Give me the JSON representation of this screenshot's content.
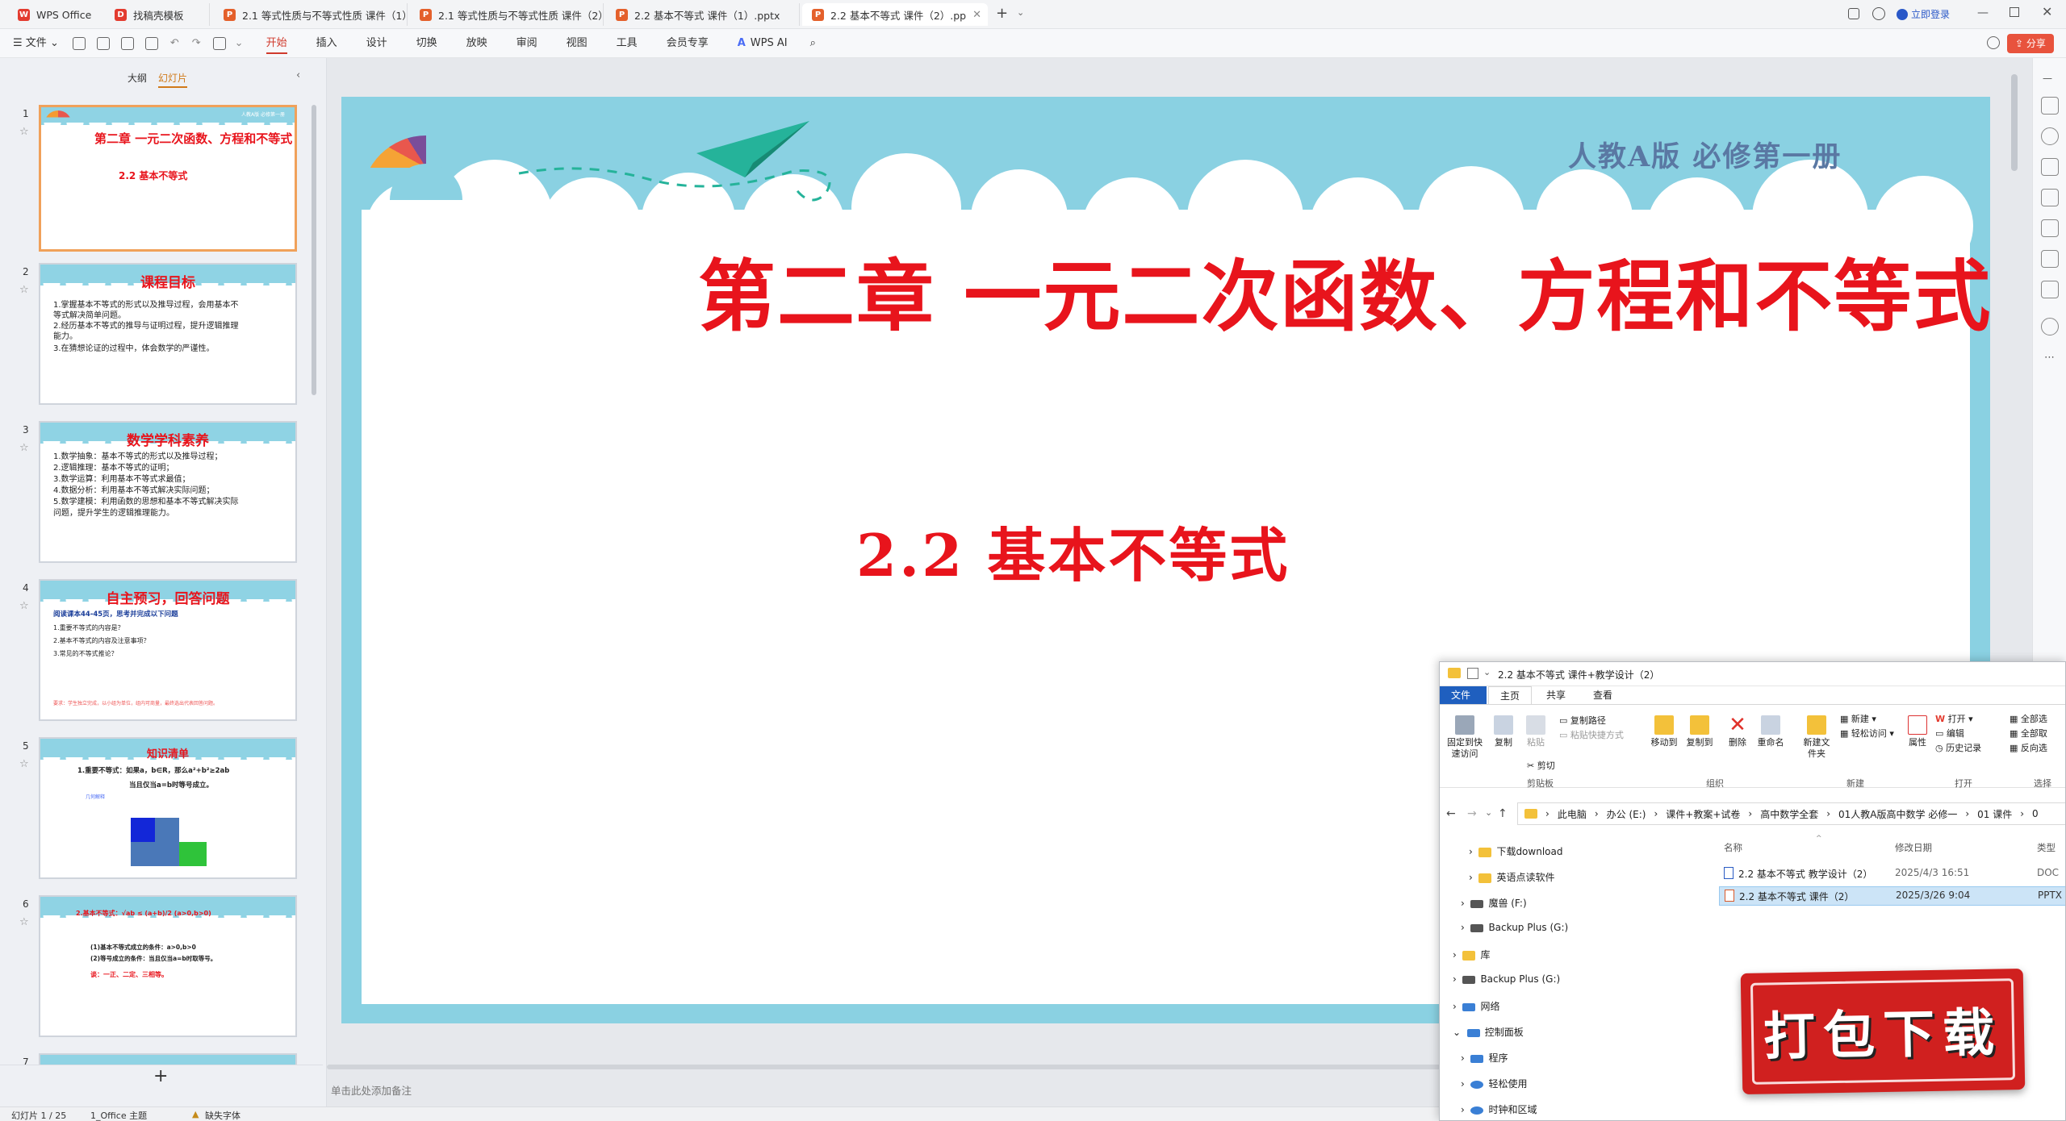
{
  "tabs": [
    {
      "label": "WPS Office",
      "color": "#e33b2f",
      "glyph": "W"
    },
    {
      "label": "找稿壳模板",
      "color": "#e33b2f",
      "glyph": "D"
    },
    {
      "label": "2.1 等式性质与不等式性质 课件（1）",
      "color": "#e4602b",
      "glyph": "P"
    },
    {
      "label": "2.1 等式性质与不等式性质 课件（2）",
      "color": "#e4602b",
      "glyph": "P"
    },
    {
      "label": "2.2 基本不等式 课件（1）.pptx",
      "color": "#e4602b",
      "glyph": "P"
    },
    {
      "label": "2.2 基本不等式 课件（2）.pp",
      "color": "#e4602b",
      "glyph": "P"
    }
  ],
  "titlebar": {
    "login": "立即登录",
    "share": "分享"
  },
  "menu": {
    "file": "文件",
    "items": [
      "开始",
      "插入",
      "设计",
      "切换",
      "放映",
      "审阅",
      "视图",
      "工具",
      "会员专享"
    ],
    "ai": "WPS AI"
  },
  "panel": {
    "outline": "大纲",
    "slides": "幻灯片",
    "add": "+"
  },
  "thumbs": [
    {
      "num": "1",
      "title": "第二章 一元二次函数、方程和不等式",
      "sub": "2.2 基本不等式",
      "tag": "人教A版 必修第一册"
    },
    {
      "num": "2",
      "title": "课程目标",
      "lines": [
        "1.掌握基本不等式的形式以及推导过程，会用基本不",
        "等式解决简单问题。",
        "2.经历基本不等式的推导与证明过程，提升逻辑推理",
        "能力。",
        "3.在猜想论证的过程中，体会数学的严谨性。"
      ]
    },
    {
      "num": "3",
      "title": "数学学科素养",
      "lines": [
        "1.数学抽象：基本不等式的形式以及推导过程；",
        "2.逻辑推理：基本不等式的证明；",
        "3.数学运算：利用基本不等式求最值；",
        "4.数据分析：利用基本不等式解决实际问题；",
        "5.数学建模：利用函数的思想和基本不等式解决实际",
        "问题，提升学生的逻辑推理能力。"
      ]
    },
    {
      "num": "4",
      "title": "自主预习，回答问题",
      "lines": [
        "阅读课本44-45页，思考并完成以下问题",
        "1.重要不等式的内容是？",
        "2.基本不等式的内容及注意事项？",
        "3.常见的不等式推论？"
      ],
      "foot": "要求：学生独立完成，以小组为单位，组内可商量，最终选出代表回答问题。"
    },
    {
      "num": "5",
      "title": "知识清单",
      "lines": [
        "1.重要不等式：如果a，b∈R，那么a²+b²≥2ab",
        "当且仅当a=b时等号成立。"
      ],
      "note": "几何解释"
    },
    {
      "num": "6",
      "title": "",
      "lines": [
        "2.基本不等式：√ab ≤ (a+b)/2 (a>0,b>0)",
        "(1)基本不等式成立的条件：a>0,b>0",
        "(2)等号成立的条件：当且仅当a=b时取等号。",
        "谈：一正、二定、三相等。"
      ]
    },
    {
      "num": "7",
      "title": ""
    }
  ],
  "slide": {
    "tag": "人教A版 必修第一册",
    "title": "第二章  一元二次函数、方程和不等式",
    "subtitle": "2.2  基本不等式",
    "notes": "单击此处添加备注",
    "badge": "打包下载"
  },
  "colors": {
    "title_red": "#e8141c",
    "sky": "#8ad1e2",
    "accent": "#d03a2c"
  },
  "status": {
    "page": "幻灯片 1 / 25",
    "theme": "1_Office 主题",
    "font": "缺失字体"
  },
  "explorer": {
    "title": "2.2 基本不等式 课件+教学设计（2）",
    "ribbon_tabs": [
      "文件",
      "主页",
      "共享",
      "查看"
    ],
    "buttons": {
      "pin": "固定到快速访问",
      "copy": "复制",
      "paste": "粘贴",
      "copy_path": "复制路径",
      "paste_shortcut": "粘贴快捷方式",
      "cut": "剪切",
      "move_to": "移动到",
      "copy_to": "复制到",
      "delete": "删除",
      "rename": "重命名",
      "new_folder": "新建文件夹",
      "new_item": "新建",
      "easy_access": "轻松访问",
      "properties": "属性",
      "open": "打开",
      "edit": "编辑",
      "history": "历史记录",
      "select_all": "全部选",
      "select_none": "全部取",
      "invert": "反向选"
    },
    "groups": {
      "clipboard": "剪贴板",
      "organize": "组织",
      "new": "新建",
      "open": "打开",
      "select": "选择"
    },
    "breadcrumb": [
      "此电脑",
      "办公 (E:)",
      "课件+教案+试卷",
      "高中数学全套",
      "01人教A版高中数学 必修一",
      "01 课件",
      "0"
    ],
    "tree": [
      {
        "label": "下载download",
        "indent": 2,
        "type": "folder"
      },
      {
        "label": "英语点读软件",
        "indent": 2,
        "type": "folder"
      },
      {
        "label": "魔兽 (F:)",
        "indent": 1,
        "type": "drive"
      },
      {
        "label": "Backup Plus (G:)",
        "indent": 1,
        "type": "drive"
      },
      {
        "label": "库",
        "indent": 0,
        "type": "folder"
      },
      {
        "label": "Backup Plus (G:)",
        "indent": 0,
        "type": "drive"
      },
      {
        "label": "网络",
        "indent": 0,
        "type": "net"
      },
      {
        "label": "控制面板",
        "indent": 0,
        "type": "cp",
        "open": true
      },
      {
        "label": "程序",
        "indent": 1,
        "type": "cp"
      },
      {
        "label": "轻松使用",
        "indent": 1,
        "type": "cp"
      },
      {
        "label": "时钟和区域",
        "indent": 1,
        "type": "cp"
      }
    ],
    "columns": {
      "name": "名称",
      "modified": "修改日期",
      "type": "类型"
    },
    "files": [
      {
        "name": "2.2 基本不等式 教学设计（2）",
        "date": "2025/4/3 16:51",
        "type": "DOC",
        "icon": "#2b5cc4"
      },
      {
        "name": "2.2 基本不等式 课件（2）",
        "date": "2025/3/26 9:04",
        "type": "PPTX",
        "icon": "#d7592b"
      }
    ]
  }
}
